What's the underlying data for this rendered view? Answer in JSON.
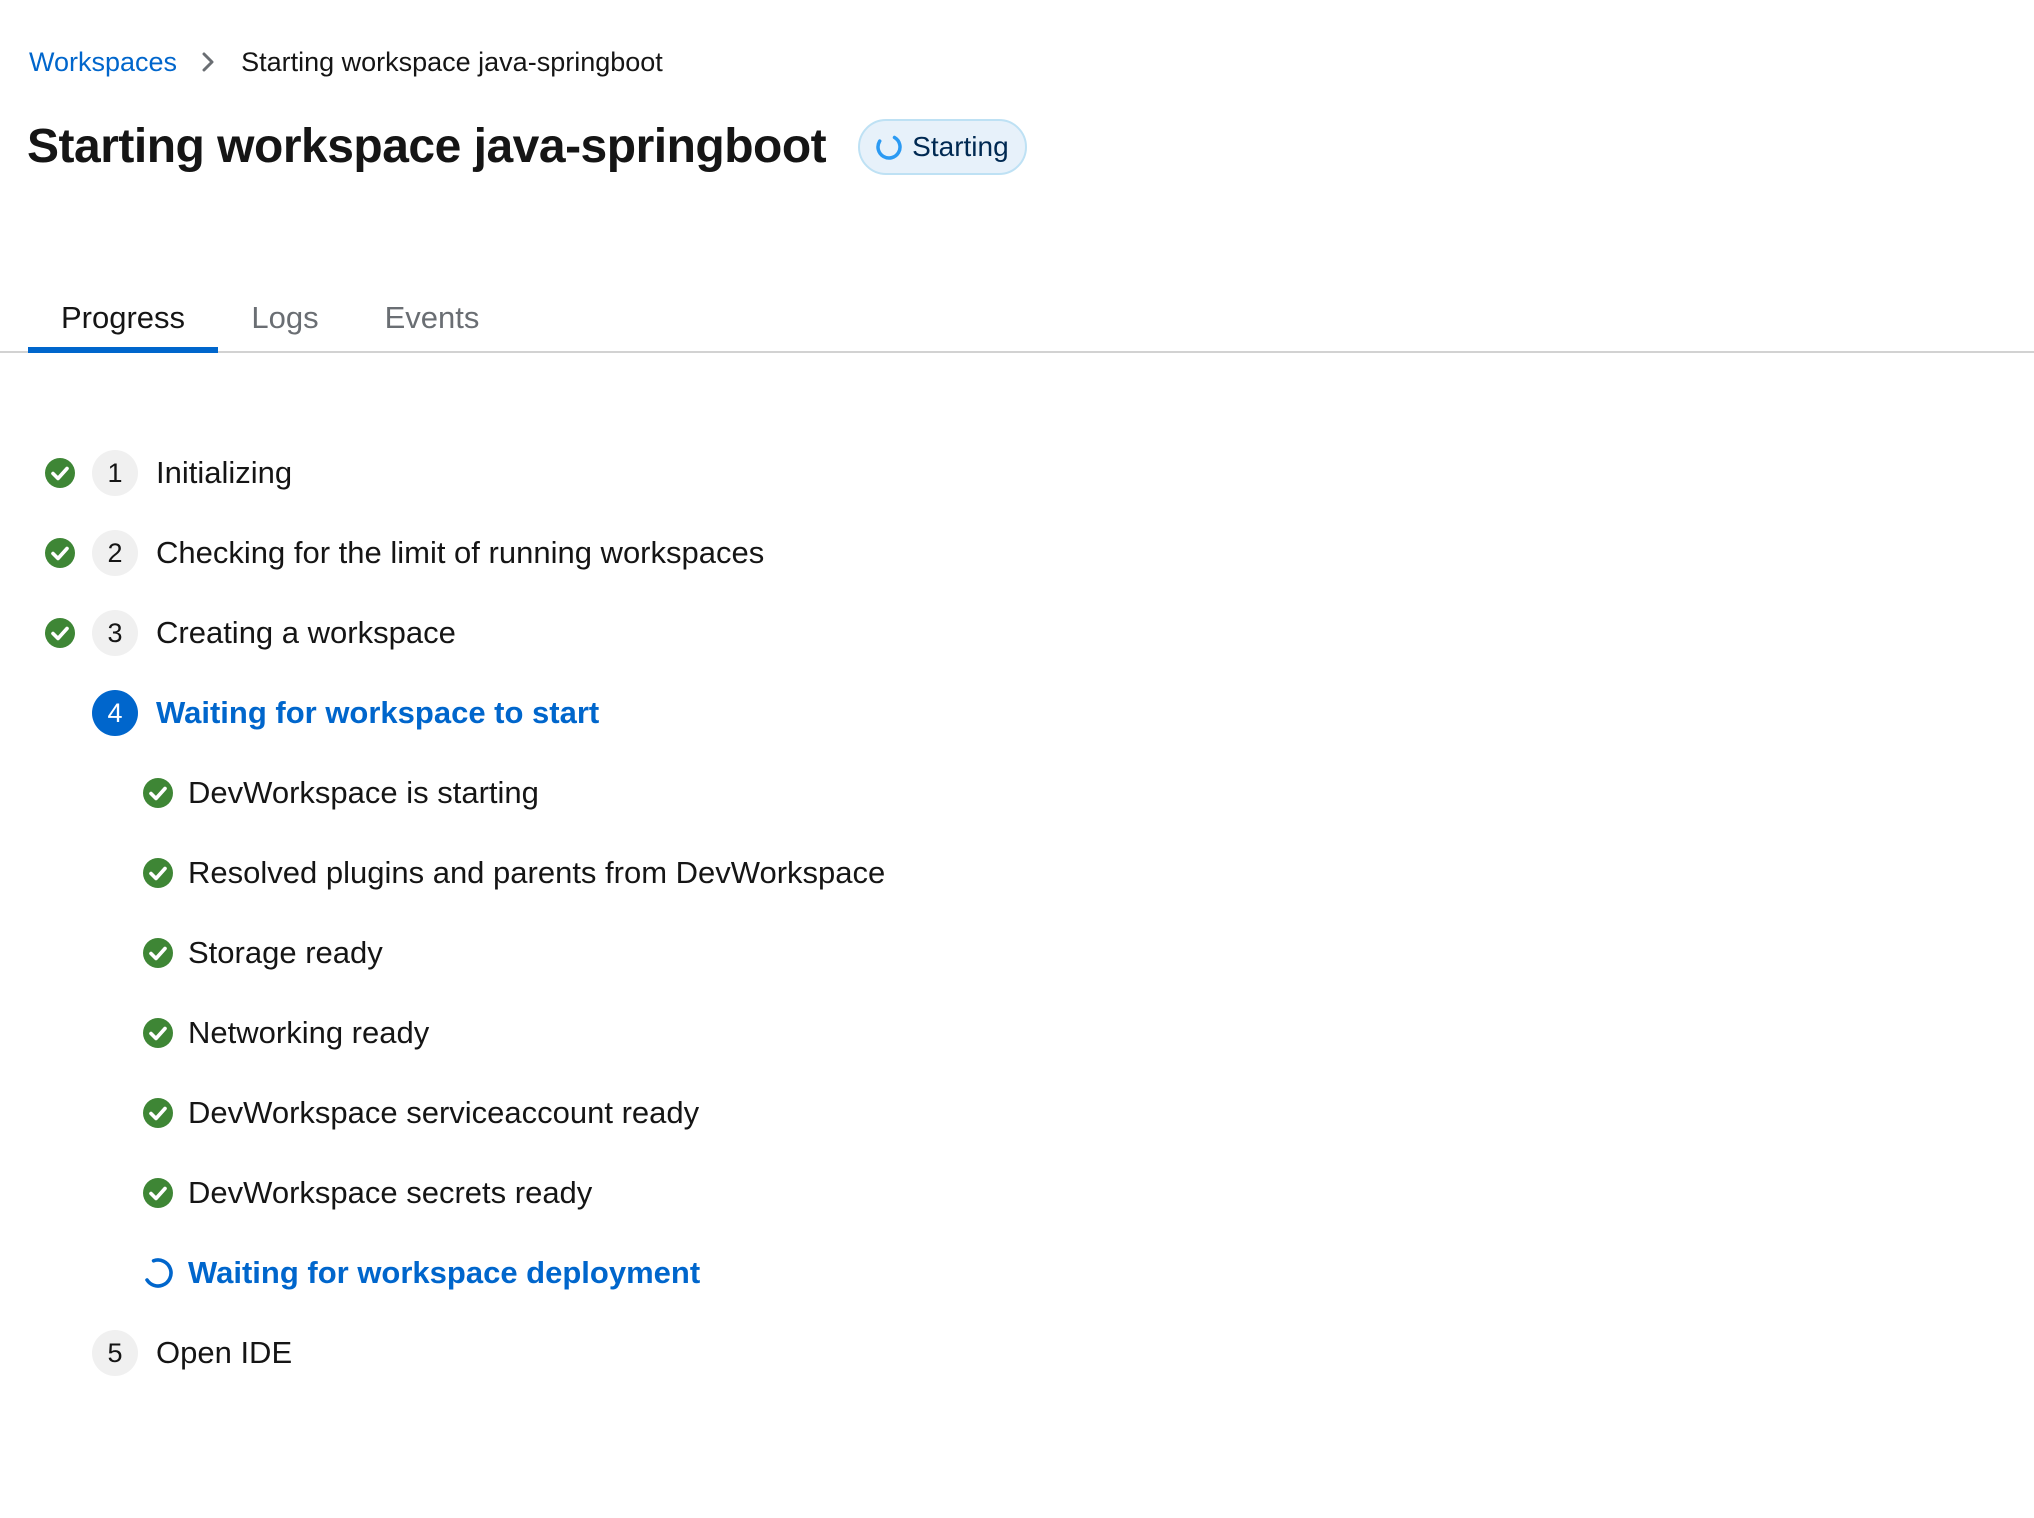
{
  "breadcrumb": {
    "parent": "Workspaces",
    "current": "Starting workspace java-springboot"
  },
  "header": {
    "title": "Starting workspace java-springboot",
    "status": "Starting"
  },
  "tabs": [
    {
      "label": "Progress",
      "active": true
    },
    {
      "label": "Logs",
      "active": false
    },
    {
      "label": "Events",
      "active": false
    }
  ],
  "steps": [
    {
      "number": "1",
      "label": "Initializing",
      "state": "done"
    },
    {
      "number": "2",
      "label": "Checking for the limit of running workspaces",
      "state": "done"
    },
    {
      "number": "3",
      "label": "Creating a workspace",
      "state": "done"
    },
    {
      "number": "4",
      "label": "Waiting for workspace to start",
      "state": "active"
    },
    {
      "number": "5",
      "label": "Open IDE",
      "state": "pending"
    }
  ],
  "substeps": [
    {
      "label": "DevWorkspace is starting",
      "state": "done"
    },
    {
      "label": "Resolved plugins and parents from DevWorkspace",
      "state": "done"
    },
    {
      "label": "Storage ready",
      "state": "done"
    },
    {
      "label": "Networking ready",
      "state": "done"
    },
    {
      "label": "DevWorkspace serviceaccount ready",
      "state": "done"
    },
    {
      "label": "DevWorkspace secrets ready",
      "state": "done"
    },
    {
      "label": "Waiting for workspace deployment",
      "state": "in-progress"
    }
  ],
  "colors": {
    "accent": "#0066cc",
    "success": "#3e8635",
    "text": "#151515",
    "muted": "#6a6e73",
    "status_bg": "#e7f1fa"
  },
  "icons": {
    "breadcrumb_separator": "chevron-right-icon",
    "status": "spinner-icon",
    "done": "check-circle-icon",
    "in_progress": "spinner-icon"
  }
}
